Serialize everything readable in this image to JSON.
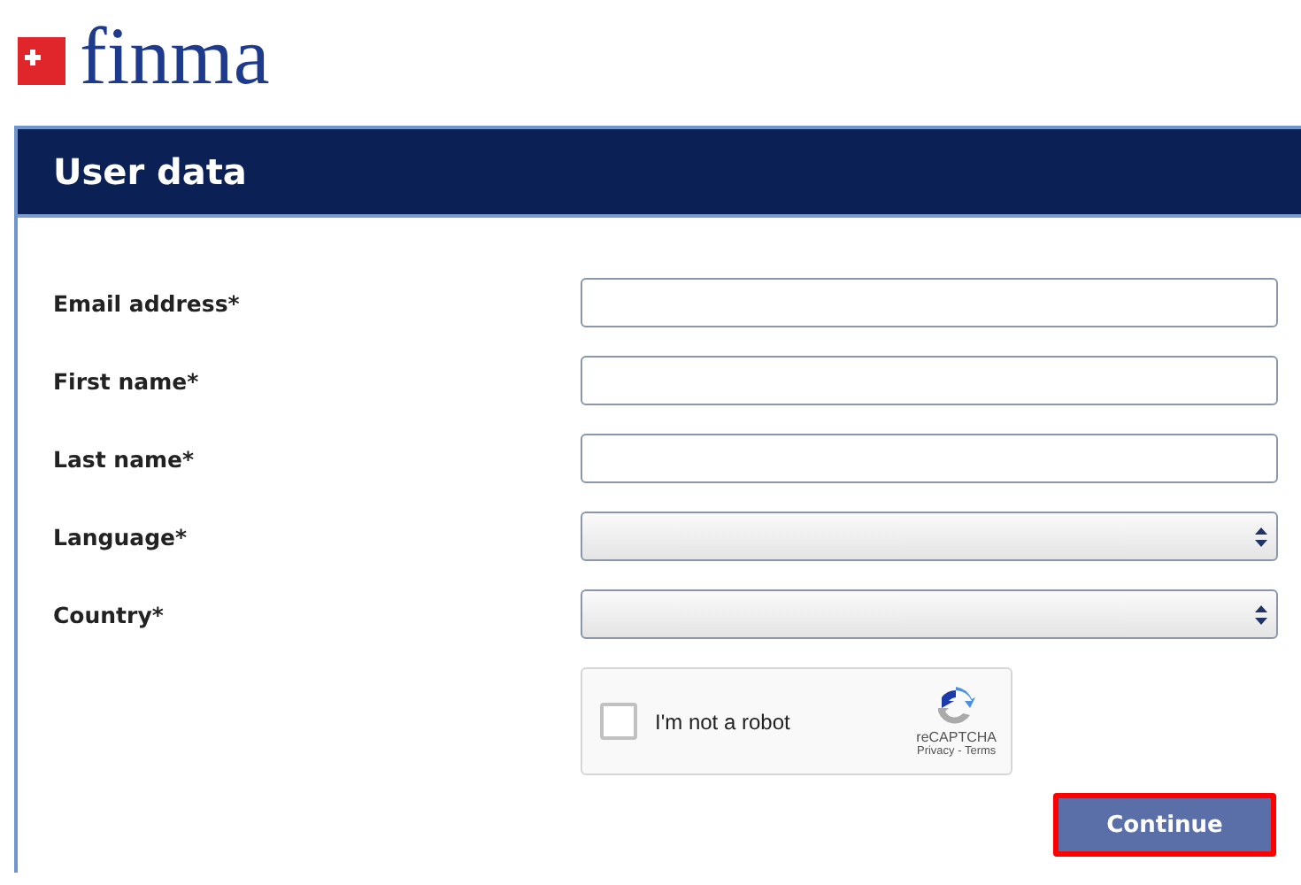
{
  "logo": {
    "text": "finma"
  },
  "header": {
    "title": "User data"
  },
  "fields": [
    {
      "label": "Email address*",
      "kind": "text"
    },
    {
      "label": "First name*",
      "kind": "text"
    },
    {
      "label": "Last name*",
      "kind": "text"
    },
    {
      "label": "Language*",
      "kind": "select"
    },
    {
      "label": "Country*",
      "kind": "select"
    }
  ],
  "captcha": {
    "label": "I'm not a robot",
    "checked": false,
    "brand": "reCAPTCHA",
    "links": "Privacy - Terms"
  },
  "submit": {
    "label": "Continue",
    "highlighted": true
  }
}
